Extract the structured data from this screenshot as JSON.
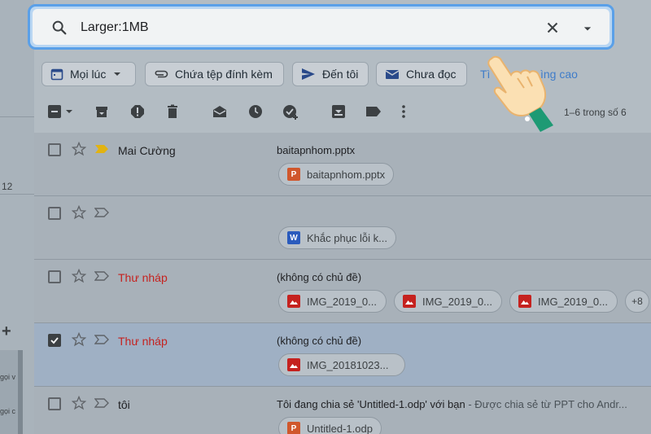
{
  "search": {
    "query": "Larger:1MB"
  },
  "filters": {
    "any_time": "Mọi lúc",
    "has_attachment": "Chứa tệp đính kèm",
    "to_me": "Đến tôi",
    "unread": "Chưa đọc",
    "advanced_prefix": "Tì",
    "advanced_suffix": "ìng cao"
  },
  "pager": {
    "text": "1–6 trong số 6"
  },
  "left_rail": {
    "count": "12",
    "snip1": "gọi v",
    "snip2": "gọi c"
  },
  "emails": [
    {
      "sender": "Mai Cường",
      "subject": "baitapnhom.pptx",
      "snippet": "",
      "attachments": [
        {
          "name": "baitapnhom.pptx",
          "type": "P"
        }
      ]
    },
    {
      "sender": "",
      "subject": "",
      "snippet": "",
      "attachments": [
        {
          "name": "Khắc phục lỗi k...",
          "type": "W"
        }
      ]
    },
    {
      "sender": "Thư nháp",
      "subject": "(không có chủ đề)",
      "snippet": "",
      "attachments": [
        {
          "name": "IMG_2019_0...",
          "type": "img"
        },
        {
          "name": "IMG_2019_0...",
          "type": "img"
        },
        {
          "name": "IMG_2019_0...",
          "type": "img"
        }
      ],
      "more": "+8"
    },
    {
      "sender": "Thư nháp",
      "subject": "(không có chủ đề)",
      "snippet": "",
      "attachments": [
        {
          "name": "IMG_20181023...",
          "type": "img"
        }
      ]
    },
    {
      "sender": "tôi",
      "subject": "Tôi đang chia sẻ 'Untitled-1.odp' với bạn",
      "snippet": " - Được chia sẻ từ PPT cho Andr...",
      "attachments": [
        {
          "name": "Untitled-1.odp",
          "type": "P"
        }
      ]
    }
  ],
  "colors": {
    "accent_blue": "#5aa0e8",
    "draft_red": "#c5221f",
    "ppt_orange": "#d0572c",
    "word_blue": "#2a5bbd",
    "img_red": "#c5221f",
    "important_yellow": "#e2b311"
  }
}
